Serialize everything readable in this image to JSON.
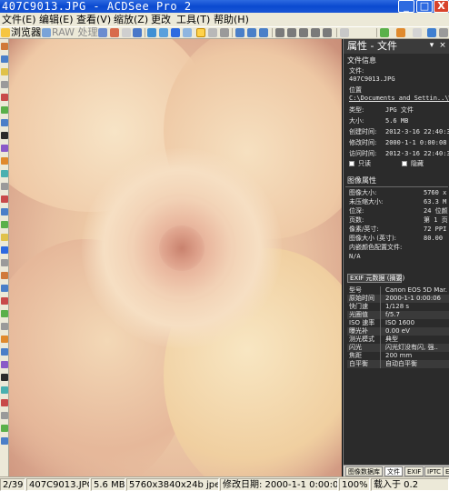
{
  "window": {
    "title": "407C9013.JPG - ACDSee Pro 2",
    "minimize_label": "_",
    "maximize_label": "□",
    "close_label": "X"
  },
  "menu": [
    "文件(E)",
    "编辑(E)",
    "查看(V)",
    "缩放(Z)",
    "更改",
    "工具(T)",
    "帮助(H)"
  ],
  "toolbar": {
    "browser_label": "浏览器",
    "raw_label": "RAW 处理"
  },
  "panel": {
    "title": "属性 - 文件",
    "file_info_title": "文件信息",
    "file_label": "文件:",
    "file_value": "407C9013.JPG",
    "location_label": "位置",
    "location_value": "C:\\Documents and Settin..\\Wi",
    "type_label": "类型:",
    "type_value": "JPG 文件",
    "size_label": "大小:",
    "size_value": "5.6 MB",
    "created_label": "创建时间:",
    "created_value": "2012-3-16 22:40:37",
    "modified_label": "修改时间:",
    "modified_value": "2000-1-1 0:00:08",
    "accessed_label": "访问时间:",
    "accessed_value": "2012-3-16 22:40:37",
    "readonly_label": "只读",
    "hidden_label": "隐藏",
    "image_props_title": "图像属性",
    "image_size_label": "图像大小:",
    "image_size_value": "5760 x",
    "uncompressed_label": "未压缩大小:",
    "uncompressed_value": "63.3 M",
    "bit_depth_label": "位深:",
    "bit_depth_value": "24 位颜",
    "pages_label": "页数:",
    "pages_value": "第 1 页",
    "pixels_label": "像素/英寸:",
    "pixels_value": "72 PPI",
    "image_inches_label": "图像大小 (英寸):",
    "image_inches_value": "80.00",
    "embedded_label": "内嵌颜色配置文件:",
    "embedded_value": "N/A",
    "exif_button": "EXIF 元数据 (摘要)",
    "exif": [
      {
        "k": "型号",
        "v": "Canon EOS 5D Mar."
      },
      {
        "k": "原始时间",
        "v": "2000-1-1 0:00:06"
      },
      {
        "k": "快门速",
        "v": "1/128 s"
      },
      {
        "k": "光圈值",
        "v": "f/5.7"
      },
      {
        "k": "ISO 速率",
        "v": "ISO 1600"
      },
      {
        "k": "曝光补",
        "v": "0.00 eV"
      },
      {
        "k": "测光模式",
        "v": "典型"
      },
      {
        "k": "闪光",
        "v": "闪光灯没有闪, 强.."
      },
      {
        "k": "焦距",
        "v": "200 mm"
      },
      {
        "k": "白平衡",
        "v": "自动白平衡"
      }
    ],
    "tabs": [
      "图像数据库",
      "文件",
      "EXIF",
      "IPTC",
      "E"
    ]
  },
  "status": {
    "index": "2/39",
    "filename": "407C9013.JPG",
    "filesize": "5.6 MB",
    "dimensions": "5760x3840x24b jpeg",
    "modified": "修改日期: 2000-1-1 0:00:08",
    "zoom": "100%",
    "load": "载入于 0.2"
  },
  "colors": {
    "titlebar": "#0b4ad0",
    "panel_bg": "#2b2b2b",
    "menu_bg": "#ece9d8"
  }
}
